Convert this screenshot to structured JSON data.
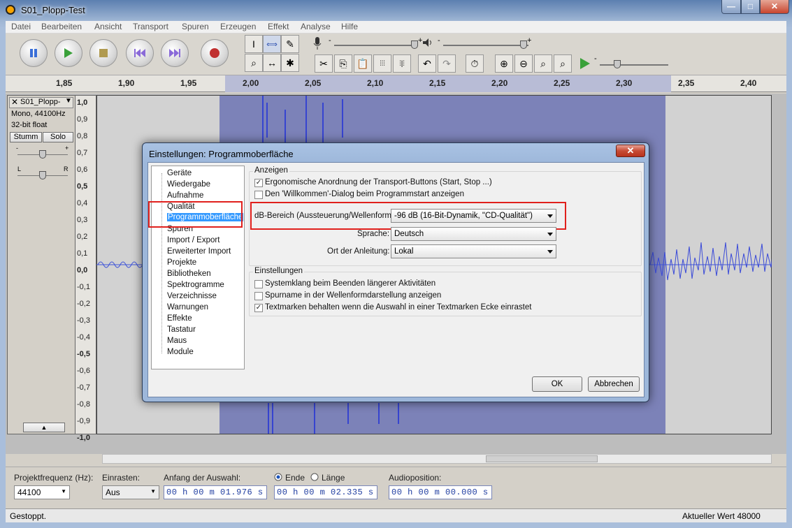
{
  "window": {
    "title": "S01_Plopp-Test",
    "minimize": "—",
    "maximize": "□",
    "close": "✕"
  },
  "menubar": [
    "Datei",
    "Bearbeiten",
    "Ansicht",
    "Transport",
    "Spuren",
    "Erzeugen",
    "Effekt",
    "Analyse",
    "Hilfe"
  ],
  "toolbar": {
    "transport": [
      "pause-icon",
      "play-icon",
      "stop-icon",
      "skip-start-icon",
      "skip-end-icon",
      "record-icon"
    ],
    "tools": [
      "I",
      "⟺",
      "✎",
      "⌕",
      "↔",
      "✱"
    ],
    "meter_minus": "-",
    "meter_plus": "+",
    "colors": {
      "pause": "#3a6fd8",
      "play": "#3aa13a",
      "stop": "#b09a50",
      "skip": "#8a6ad8",
      "record": "#c03030"
    }
  },
  "ruler": {
    "ticks": [
      "1,85",
      "1,90",
      "1,95",
      "2,00",
      "2,05",
      "2,10",
      "2,15",
      "2,20",
      "2,25",
      "2,30",
      "2,35",
      "2,40"
    ]
  },
  "track": {
    "name": "S01_Plopp-",
    "format": "Mono, 44100Hz",
    "bitdepth": "32-bit float",
    "mute": "Stumm",
    "solo": "Solo",
    "gain_minus": "-",
    "gain_plus": "+",
    "pan_left": "L",
    "pan_right": "R",
    "collapse": "▲"
  },
  "vruler": [
    "1,0",
    "0,9",
    "0,8",
    "0,7",
    "0,6",
    "0,5",
    "0,4",
    "0,3",
    "0,2",
    "0,1",
    "0,0",
    "-0,1",
    "-0,2",
    "-0,3",
    "-0,4",
    "-0,5",
    "-0,6",
    "-0,7",
    "-0,8",
    "-0,9",
    "-1,0"
  ],
  "bottom": {
    "rate_label": "Projektfrequenz (Hz):",
    "rate_value": "44100",
    "snap_label": "Einrasten:",
    "snap_value": "Aus",
    "start_label": "Anfang der Auswahl:",
    "start_value": "00 h 00 m 01.976 s",
    "end_label": "Ende",
    "length_label": "Länge",
    "end_value": "00 h 00 m 02.335 s",
    "audiopos_label": "Audioposition:",
    "audiopos_value": "00 h 00 m 00.000 s"
  },
  "status": {
    "left": "Gestoppt.",
    "right": "Aktueller Wert 48000"
  },
  "dialog": {
    "title": "Einstellungen: Programmoberfläche",
    "close": "✕",
    "tree": [
      "Geräte",
      "Wiedergabe",
      "Aufnahme",
      "Qualität",
      "Programmoberfläche",
      "Spuren",
      "Import / Export",
      "Erweiterter Import",
      "Projekte",
      "Bibliotheken",
      "Spektrogramme",
      "Verzeichnisse",
      "Warnungen",
      "Effekte",
      "Tastatur",
      "Maus",
      "Module"
    ],
    "group1": "Anzeigen",
    "opt1": "Ergonomische Anordnung der Transport-Buttons (Start, Stop ...)",
    "opt2": "Den 'Willkommen'-Dialog beim Programmstart anzeigen",
    "db_label": "dB-Bereich (Aussteuerung/Wellenform):",
    "db_value": "-96 dB (16-Bit-Dynamik, \"CD-Qualität\")",
    "lang_label": "Sprache:",
    "lang_value": "Deutsch",
    "help_label": "Ort der Anleitung:",
    "help_value": "Lokal",
    "group2": "Einstellungen",
    "opt3": "Systemklang beim Beenden längerer Aktivitäten",
    "opt4": "Spurname in der Wellenformdarstellung anzeigen",
    "opt5": "Textmarken behalten wenn die Auswahl in einer Textmarken Ecke einrastet",
    "ok": "OK",
    "cancel": "Abbrechen"
  }
}
